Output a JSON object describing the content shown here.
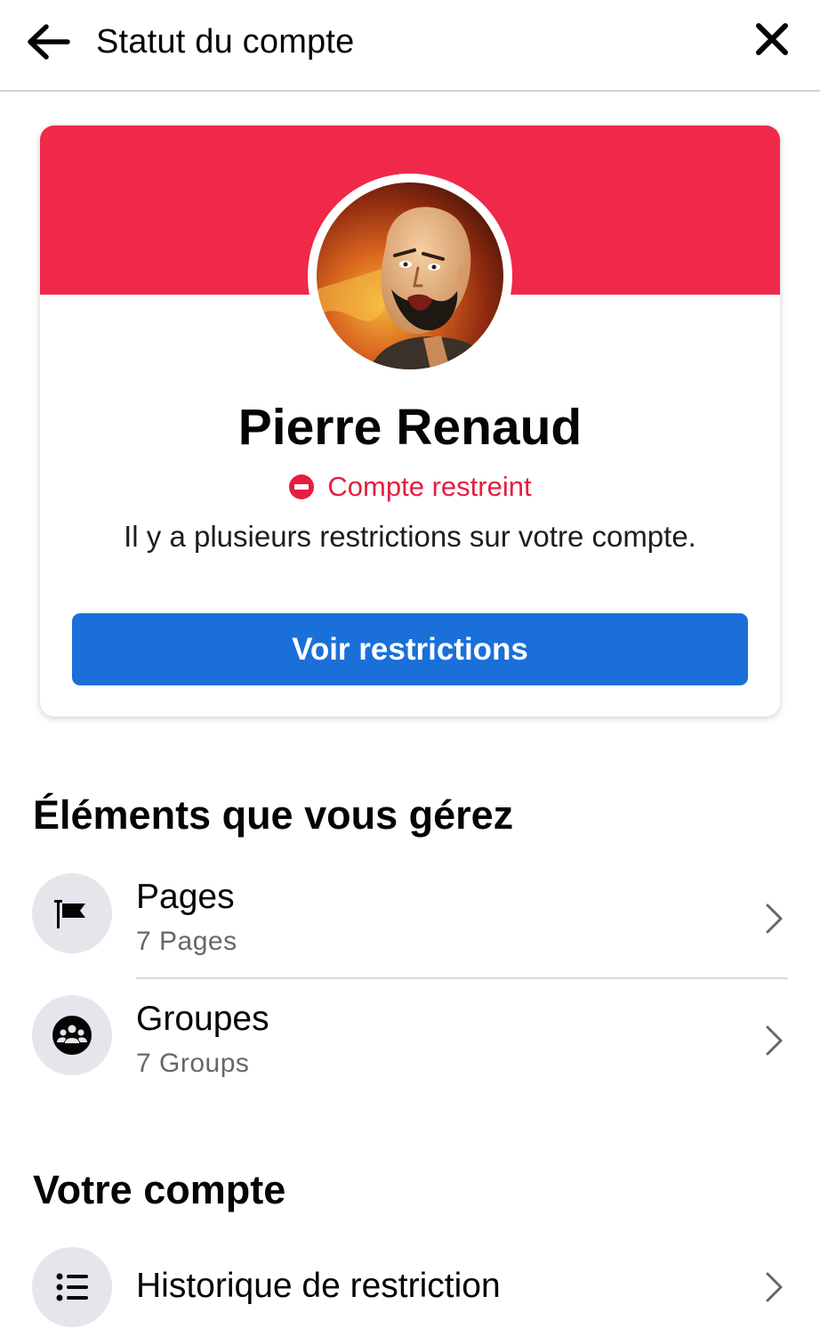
{
  "header": {
    "title": "Statut du compte",
    "back_icon": "arrow-left-icon",
    "close_icon": "close-icon"
  },
  "profile": {
    "name": "Pierre Renaud",
    "status": "Compte restreint",
    "status_icon": "restricted-icon",
    "description": "Il y a plusieurs restrictions sur votre compte.",
    "banner_color": "#f0284a",
    "status_color": "#e41e3f"
  },
  "actions": {
    "view_restrictions_label": "Voir restrictions",
    "button_color": "#1b6fd9"
  },
  "managed": {
    "title": "Éléments que vous gérez",
    "items": [
      {
        "title": "Pages",
        "subtitle": "7 Pages",
        "icon": "flag-icon"
      },
      {
        "title": "Groupes",
        "subtitle": "7 Groups",
        "icon": "groups-icon"
      }
    ]
  },
  "account": {
    "title": "Votre compte",
    "items": [
      {
        "title": "Historique de restriction",
        "icon": "list-icon"
      }
    ]
  }
}
